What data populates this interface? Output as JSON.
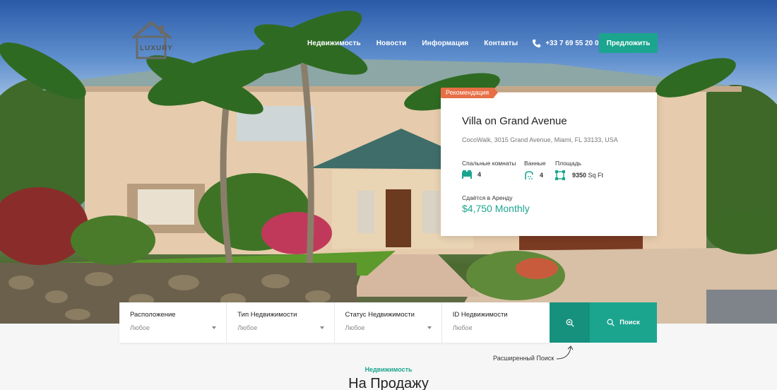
{
  "header": {
    "logo_text": "LUXURY",
    "nav": [
      "Недвижимость",
      "Новости",
      "Информация",
      "Контакты"
    ],
    "phone": "+33 7 69 55 20 07",
    "offer_button": "Предложить"
  },
  "featured": {
    "badge": "Рекомендация",
    "title": "Villa on Grand Avenue",
    "address": "CocoWalk, 3015 Grand Avenue, Miami, FL 33133, USA",
    "bedrooms_label": "Спальные комнаты",
    "bedrooms_value": "4",
    "bathrooms_label": "Ванные",
    "bathrooms_value": "4",
    "area_label": "Площадь",
    "area_value": "9350",
    "area_unit": "Sq Ft",
    "status_label": "Сдаётся в Аренду",
    "price": "$4,750 Monthly"
  },
  "search": {
    "fields": [
      {
        "label": "Расположение",
        "value": "Любое"
      },
      {
        "label": "Тип Недвижимости",
        "value": "Любое"
      },
      {
        "label": "Статус Недвижимости",
        "value": "Любое"
      },
      {
        "label": "ID Недвижимости",
        "placeholder": "Любое"
      }
    ],
    "search_button": "Поиск",
    "advanced_label": "Расширенный Поиск"
  },
  "section": {
    "kicker": "Недвижимость",
    "title": "На Продажу"
  },
  "colors": {
    "accent": "#1ba58f",
    "accent_dark": "#16917e",
    "badge": "#e86f45"
  }
}
